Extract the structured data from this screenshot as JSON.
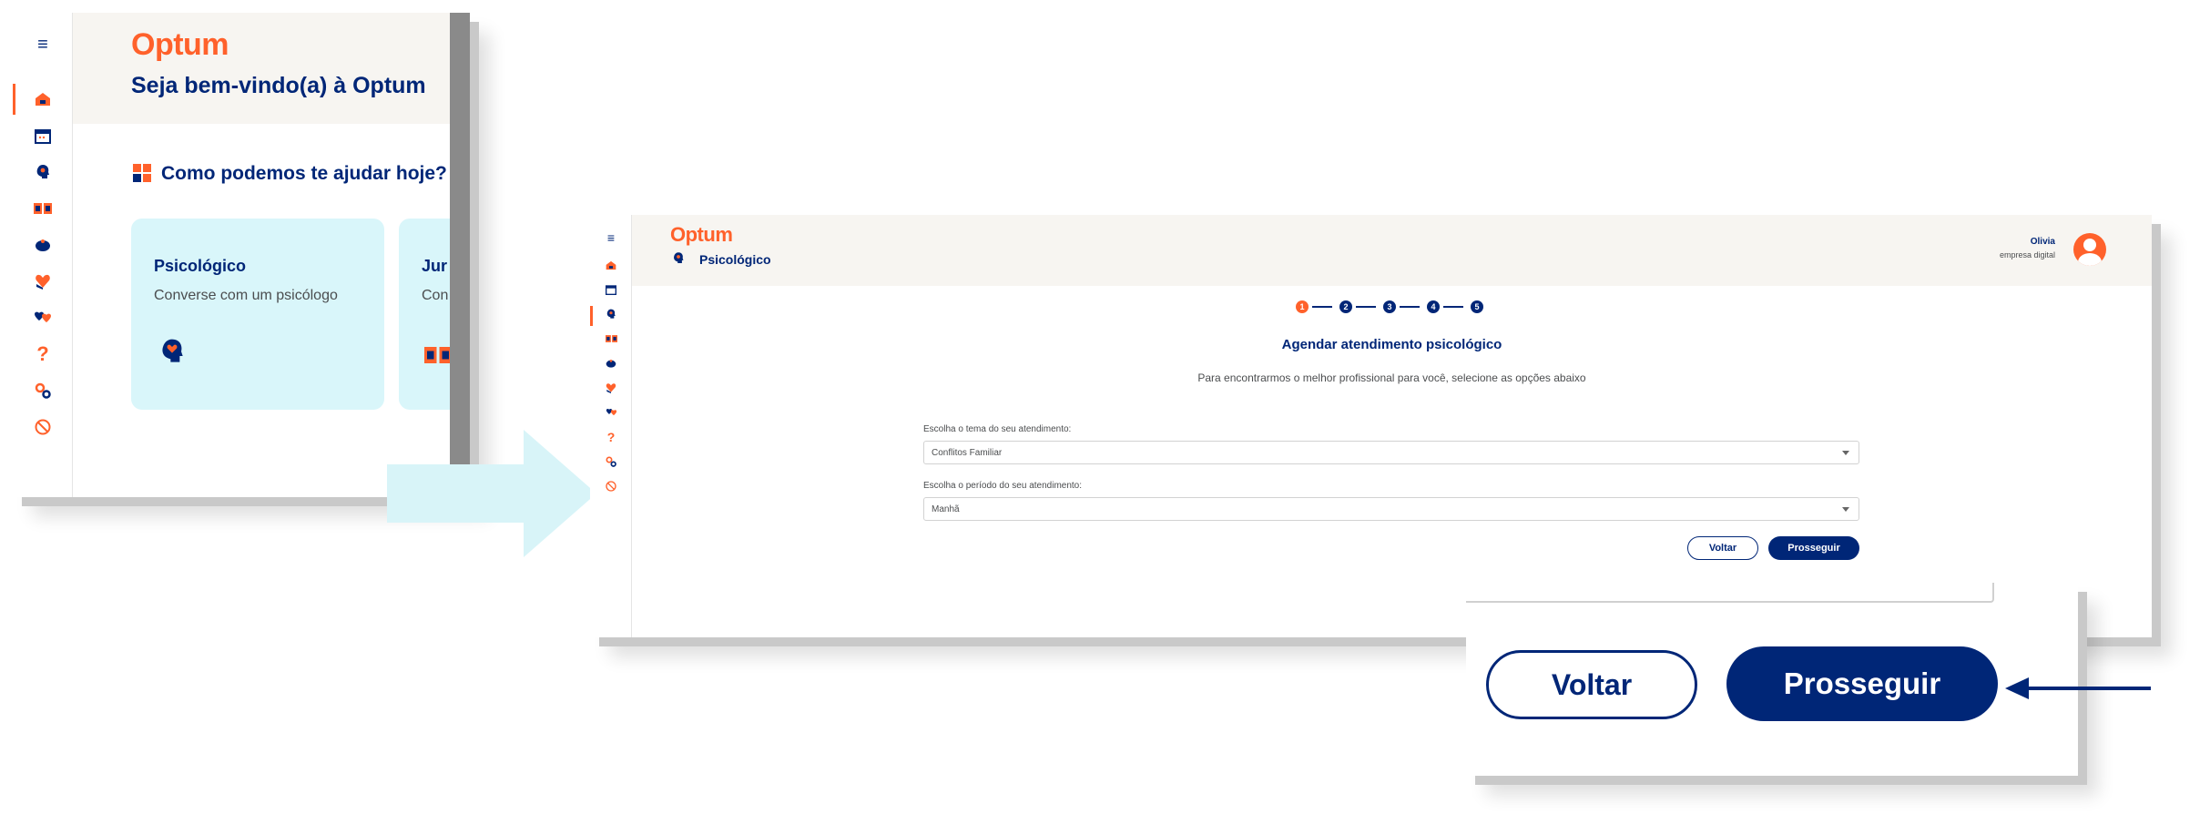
{
  "colors": {
    "brand": "#ff612b",
    "navy": "#002677",
    "card_bg": "#d9f6fa",
    "arrow_bg": "#d8f4f8"
  },
  "panel1": {
    "brand": "Optum",
    "welcome": "Seja bem-vindo(a) à Optum",
    "help_title": "Como podemos te ajudar hoje?",
    "cards": [
      {
        "title": "Psicológico",
        "subtitle": "Converse com um psicólogo",
        "icon": "head-heart-icon"
      },
      {
        "title": "Jur",
        "subtitle": "Con",
        "icon": "document-icon"
      }
    ],
    "rail_icons": [
      "menu-icon",
      "home-icon",
      "calendar-icon",
      "head-icon",
      "document-icon",
      "piggy-bank-icon",
      "heart-hand-icon",
      "heart-chat-icon",
      "question-icon",
      "gears-icon",
      "block-icon"
    ]
  },
  "panel2": {
    "brand": "Optum",
    "section": "Psicológico",
    "user_name": "Olivia",
    "user_company": "empresa digital",
    "steps": [
      "1",
      "2",
      "3",
      "4",
      "5"
    ],
    "title": "Agendar atendimento psicológico",
    "subtitle": "Para encontrarmos o melhor profissional para você, selecione as opções abaixo",
    "field1_label": "Escolha o tema do seu atendimento:",
    "field1_value": "Conflitos Familiar",
    "field2_label": "Escolha o período do seu atendimento:",
    "field2_value": "Manhã",
    "back_label": "Voltar",
    "next_label": "Prosseguir"
  },
  "zoom": {
    "back_label": "Voltar",
    "next_label": "Prosseguir"
  }
}
